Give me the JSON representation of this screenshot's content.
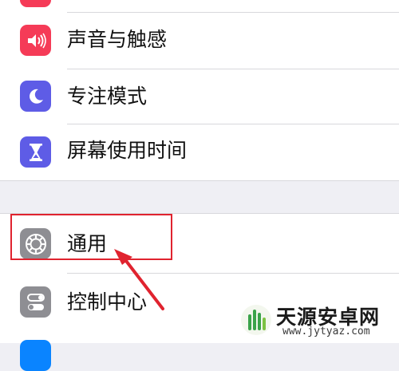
{
  "settings_list": {
    "items": [
      {
        "label": "声音与触感",
        "icon": "speaker-wave-icon",
        "color": "#f53b57"
      },
      {
        "label": "专注模式",
        "icon": "moon-icon",
        "color": "#5e5ce6"
      },
      {
        "label": "屏幕使用时间",
        "icon": "hourglass-icon",
        "color": "#5e5ce6"
      },
      {
        "label": "通用",
        "icon": "gear-icon",
        "color": "#8e8e93"
      },
      {
        "label": "控制中心",
        "icon": "toggle-switch-icon",
        "color": "#8e8e93"
      }
    ]
  },
  "annotation": {
    "highlight_color": "#e0232f",
    "arrow_color": "#e0232f"
  },
  "watermark": {
    "title": "天源安卓网",
    "url": "www.jytyaz.com"
  }
}
